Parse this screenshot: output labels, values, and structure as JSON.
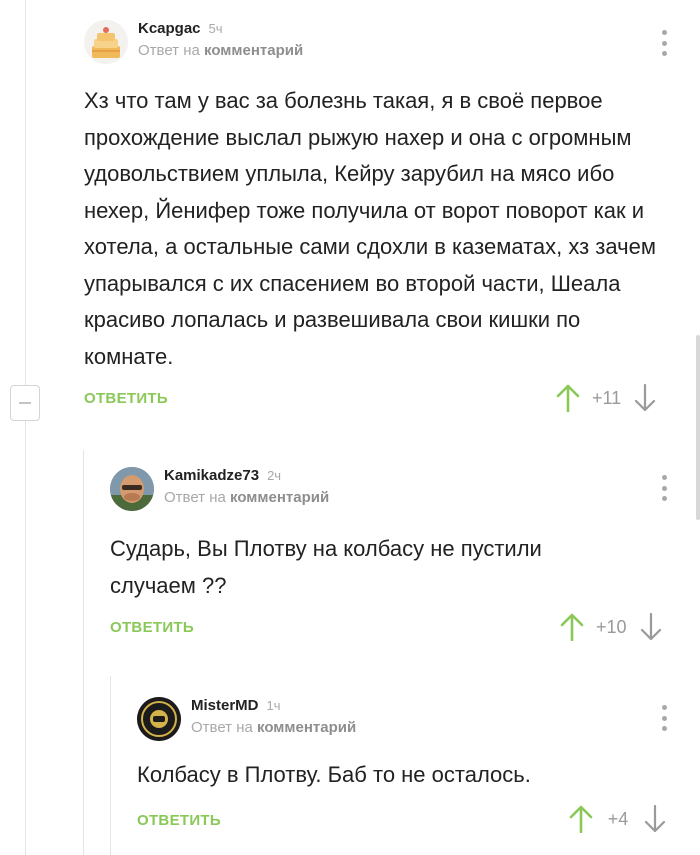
{
  "colors": {
    "accent_green": "#8ac858",
    "muted": "#a8a8a8",
    "text": "#222222"
  },
  "comments": [
    {
      "author": "Kcapgac",
      "time": "5ч",
      "reply_prefix": "Ответ на",
      "reply_target": "комментарий",
      "text": "Хз что там у вас за болезнь такая, я в своё первое прохождение выслал рыжую нахер и она с огромным удовольствием уплыла, Кейру зарубил на мясо ибо нехер, Йенифер тоже получила от ворот поворот как и хотела, а остальные сами сдохли в казематах, хз зачем упарывался с их спасением во второй части, Шеала красиво лопалась и развешивала свои кишки по комнате.",
      "reply_label": "ОТВЕТИТЬ",
      "score": "+11",
      "avatar_icon": "cake-avatar-icon"
    },
    {
      "author": "Kamikadze73",
      "time": "2ч",
      "reply_prefix": "Ответ на",
      "reply_target": "комментарий",
      "text": "Сударь, Вы Плотву на колбасу не пустили случаем ??",
      "reply_label": "ОТВЕТИТЬ",
      "score": "+10",
      "avatar_icon": "user-photo-avatar-icon"
    },
    {
      "author": "MisterMD",
      "time": "1ч",
      "reply_prefix": "Ответ на",
      "reply_target": "комментарий",
      "text": "Колбасу в Плотву. Баб то не осталось.",
      "reply_label": "ОТВЕТИТЬ",
      "score": "+4",
      "avatar_icon": "fist-logo-avatar-icon"
    }
  ]
}
